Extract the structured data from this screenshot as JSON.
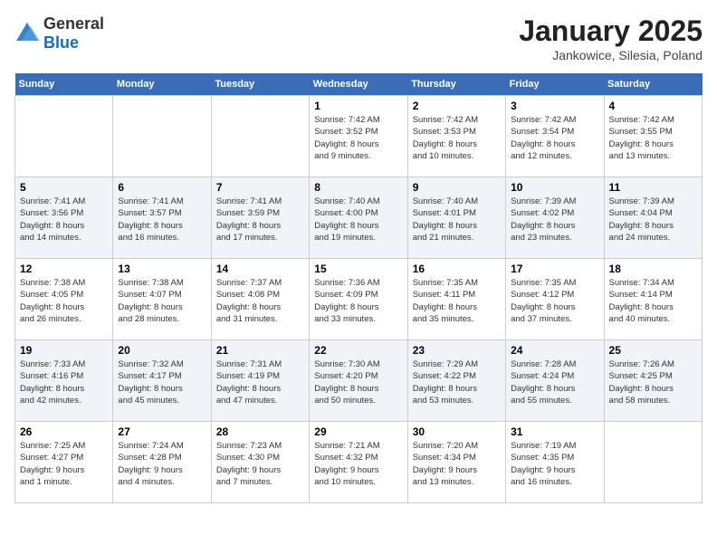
{
  "header": {
    "logo_general": "General",
    "logo_blue": "Blue",
    "month_title": "January 2025",
    "location": "Jankowice, Silesia, Poland"
  },
  "weekdays": [
    "Sunday",
    "Monday",
    "Tuesday",
    "Wednesday",
    "Thursday",
    "Friday",
    "Saturday"
  ],
  "weeks": [
    [
      {
        "day": "",
        "info": ""
      },
      {
        "day": "",
        "info": ""
      },
      {
        "day": "",
        "info": ""
      },
      {
        "day": "1",
        "info": "Sunrise: 7:42 AM\nSunset: 3:52 PM\nDaylight: 8 hours\nand 9 minutes."
      },
      {
        "day": "2",
        "info": "Sunrise: 7:42 AM\nSunset: 3:53 PM\nDaylight: 8 hours\nand 10 minutes."
      },
      {
        "day": "3",
        "info": "Sunrise: 7:42 AM\nSunset: 3:54 PM\nDaylight: 8 hours\nand 12 minutes."
      },
      {
        "day": "4",
        "info": "Sunrise: 7:42 AM\nSunset: 3:55 PM\nDaylight: 8 hours\nand 13 minutes."
      }
    ],
    [
      {
        "day": "5",
        "info": "Sunrise: 7:41 AM\nSunset: 3:56 PM\nDaylight: 8 hours\nand 14 minutes."
      },
      {
        "day": "6",
        "info": "Sunrise: 7:41 AM\nSunset: 3:57 PM\nDaylight: 8 hours\nand 16 minutes."
      },
      {
        "day": "7",
        "info": "Sunrise: 7:41 AM\nSunset: 3:59 PM\nDaylight: 8 hours\nand 17 minutes."
      },
      {
        "day": "8",
        "info": "Sunrise: 7:40 AM\nSunset: 4:00 PM\nDaylight: 8 hours\nand 19 minutes."
      },
      {
        "day": "9",
        "info": "Sunrise: 7:40 AM\nSunset: 4:01 PM\nDaylight: 8 hours\nand 21 minutes."
      },
      {
        "day": "10",
        "info": "Sunrise: 7:39 AM\nSunset: 4:02 PM\nDaylight: 8 hours\nand 23 minutes."
      },
      {
        "day": "11",
        "info": "Sunrise: 7:39 AM\nSunset: 4:04 PM\nDaylight: 8 hours\nand 24 minutes."
      }
    ],
    [
      {
        "day": "12",
        "info": "Sunrise: 7:38 AM\nSunset: 4:05 PM\nDaylight: 8 hours\nand 26 minutes."
      },
      {
        "day": "13",
        "info": "Sunrise: 7:38 AM\nSunset: 4:07 PM\nDaylight: 8 hours\nand 28 minutes."
      },
      {
        "day": "14",
        "info": "Sunrise: 7:37 AM\nSunset: 4:08 PM\nDaylight: 8 hours\nand 31 minutes."
      },
      {
        "day": "15",
        "info": "Sunrise: 7:36 AM\nSunset: 4:09 PM\nDaylight: 8 hours\nand 33 minutes."
      },
      {
        "day": "16",
        "info": "Sunrise: 7:35 AM\nSunset: 4:11 PM\nDaylight: 8 hours\nand 35 minutes."
      },
      {
        "day": "17",
        "info": "Sunrise: 7:35 AM\nSunset: 4:12 PM\nDaylight: 8 hours\nand 37 minutes."
      },
      {
        "day": "18",
        "info": "Sunrise: 7:34 AM\nSunset: 4:14 PM\nDaylight: 8 hours\nand 40 minutes."
      }
    ],
    [
      {
        "day": "19",
        "info": "Sunrise: 7:33 AM\nSunset: 4:16 PM\nDaylight: 8 hours\nand 42 minutes."
      },
      {
        "day": "20",
        "info": "Sunrise: 7:32 AM\nSunset: 4:17 PM\nDaylight: 8 hours\nand 45 minutes."
      },
      {
        "day": "21",
        "info": "Sunrise: 7:31 AM\nSunset: 4:19 PM\nDaylight: 8 hours\nand 47 minutes."
      },
      {
        "day": "22",
        "info": "Sunrise: 7:30 AM\nSunset: 4:20 PM\nDaylight: 8 hours\nand 50 minutes."
      },
      {
        "day": "23",
        "info": "Sunrise: 7:29 AM\nSunset: 4:22 PM\nDaylight: 8 hours\nand 53 minutes."
      },
      {
        "day": "24",
        "info": "Sunrise: 7:28 AM\nSunset: 4:24 PM\nDaylight: 8 hours\nand 55 minutes."
      },
      {
        "day": "25",
        "info": "Sunrise: 7:26 AM\nSunset: 4:25 PM\nDaylight: 8 hours\nand 58 minutes."
      }
    ],
    [
      {
        "day": "26",
        "info": "Sunrise: 7:25 AM\nSunset: 4:27 PM\nDaylight: 9 hours\nand 1 minute."
      },
      {
        "day": "27",
        "info": "Sunrise: 7:24 AM\nSunset: 4:28 PM\nDaylight: 9 hours\nand 4 minutes."
      },
      {
        "day": "28",
        "info": "Sunrise: 7:23 AM\nSunset: 4:30 PM\nDaylight: 9 hours\nand 7 minutes."
      },
      {
        "day": "29",
        "info": "Sunrise: 7:21 AM\nSunset: 4:32 PM\nDaylight: 9 hours\nand 10 minutes."
      },
      {
        "day": "30",
        "info": "Sunrise: 7:20 AM\nSunset: 4:34 PM\nDaylight: 9 hours\nand 13 minutes."
      },
      {
        "day": "31",
        "info": "Sunrise: 7:19 AM\nSunset: 4:35 PM\nDaylight: 9 hours\nand 16 minutes."
      },
      {
        "day": "",
        "info": ""
      }
    ]
  ]
}
